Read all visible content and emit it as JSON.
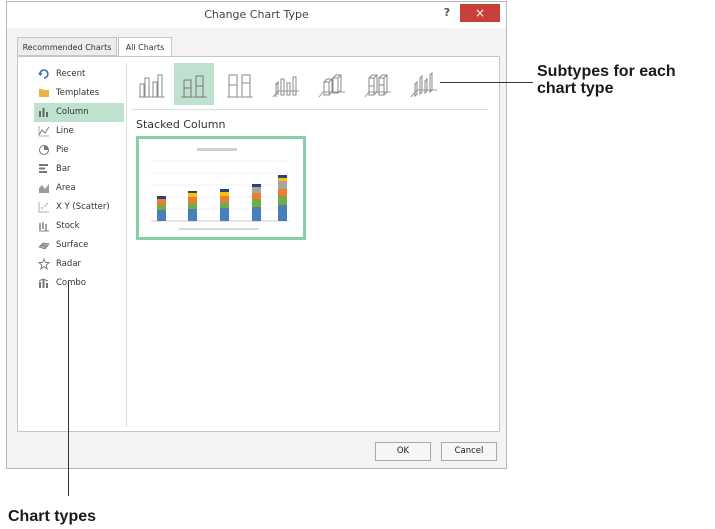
{
  "dialog": {
    "title": "Change Chart Type",
    "help_label": "?",
    "close_label": "×",
    "tabs": [
      {
        "label": "Recommended Charts"
      },
      {
        "label": "All Charts"
      }
    ],
    "chart_types": [
      {
        "label": "Recent",
        "icon": "recent-icon"
      },
      {
        "label": "Templates",
        "icon": "folder-icon"
      },
      {
        "label": "Column",
        "icon": "column-chart-icon"
      },
      {
        "label": "Line",
        "icon": "line-chart-icon"
      },
      {
        "label": "Pie",
        "icon": "pie-chart-icon"
      },
      {
        "label": "Bar",
        "icon": "bar-chart-icon"
      },
      {
        "label": "Area",
        "icon": "area-chart-icon"
      },
      {
        "label": "X Y (Scatter)",
        "icon": "scatter-chart-icon"
      },
      {
        "label": "Stock",
        "icon": "stock-chart-icon"
      },
      {
        "label": "Surface",
        "icon": "surface-chart-icon"
      },
      {
        "label": "Radar",
        "icon": "radar-chart-icon"
      },
      {
        "label": "Combo",
        "icon": "combo-chart-icon"
      }
    ],
    "selected_type": "Column",
    "selected_subtype_name": "Stacked Column",
    "ok_label": "OK",
    "cancel_label": "Cancel"
  },
  "callouts": {
    "subtypes_line1": "Subtypes for each",
    "subtypes_line2": "chart type",
    "chart_types": "Chart types"
  },
  "colors": {
    "selection": "#bfe1cf",
    "preview_border": "#86cfa7",
    "close_button": "#c9403a",
    "series": [
      "#4a7ebb",
      "#70ad47",
      "#ed7d31",
      "#a5a5a5",
      "#ffc000",
      "#264478"
    ]
  }
}
